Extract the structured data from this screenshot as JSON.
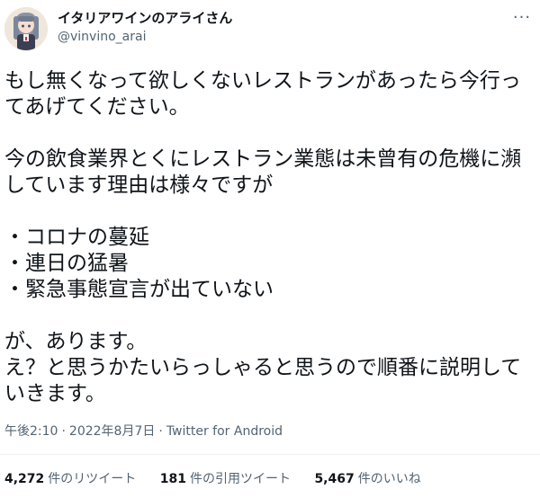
{
  "user": {
    "display_name": "イタリアワインのアライさん",
    "handle": "@vinvino_arai"
  },
  "tweet": {
    "text": "もし無くなって欲しくないレストランがあったら今行ってあげてください。\n\n今の飲食業界とくにレストラン業態は未曾有の危機に瀕しています理由は様々ですが\n\n・コロナの蔓延\n・連日の猛暑\n・緊急事態宣言が出ていない\n\nが、あります。\nえ？と思うかたいらっしゃると思うので順番に説明していきます。",
    "time": "午後2:10",
    "date": "2022年8月7日",
    "separator": "·",
    "source": "Twitter for Android"
  },
  "stats": {
    "retweets": {
      "count": "4,272",
      "label": "件のリツイート"
    },
    "quotes": {
      "count": "181",
      "label": "件の引用ツイート"
    },
    "likes": {
      "count": "5,467",
      "label": "件のいいね"
    }
  },
  "icons": {
    "more": "more-options-icon",
    "avatar": "anime-character-avatar"
  },
  "colors": {
    "text_primary": "#0f1419",
    "text_secondary": "#536471",
    "divider": "#eff3f4",
    "background": "#ffffff"
  }
}
